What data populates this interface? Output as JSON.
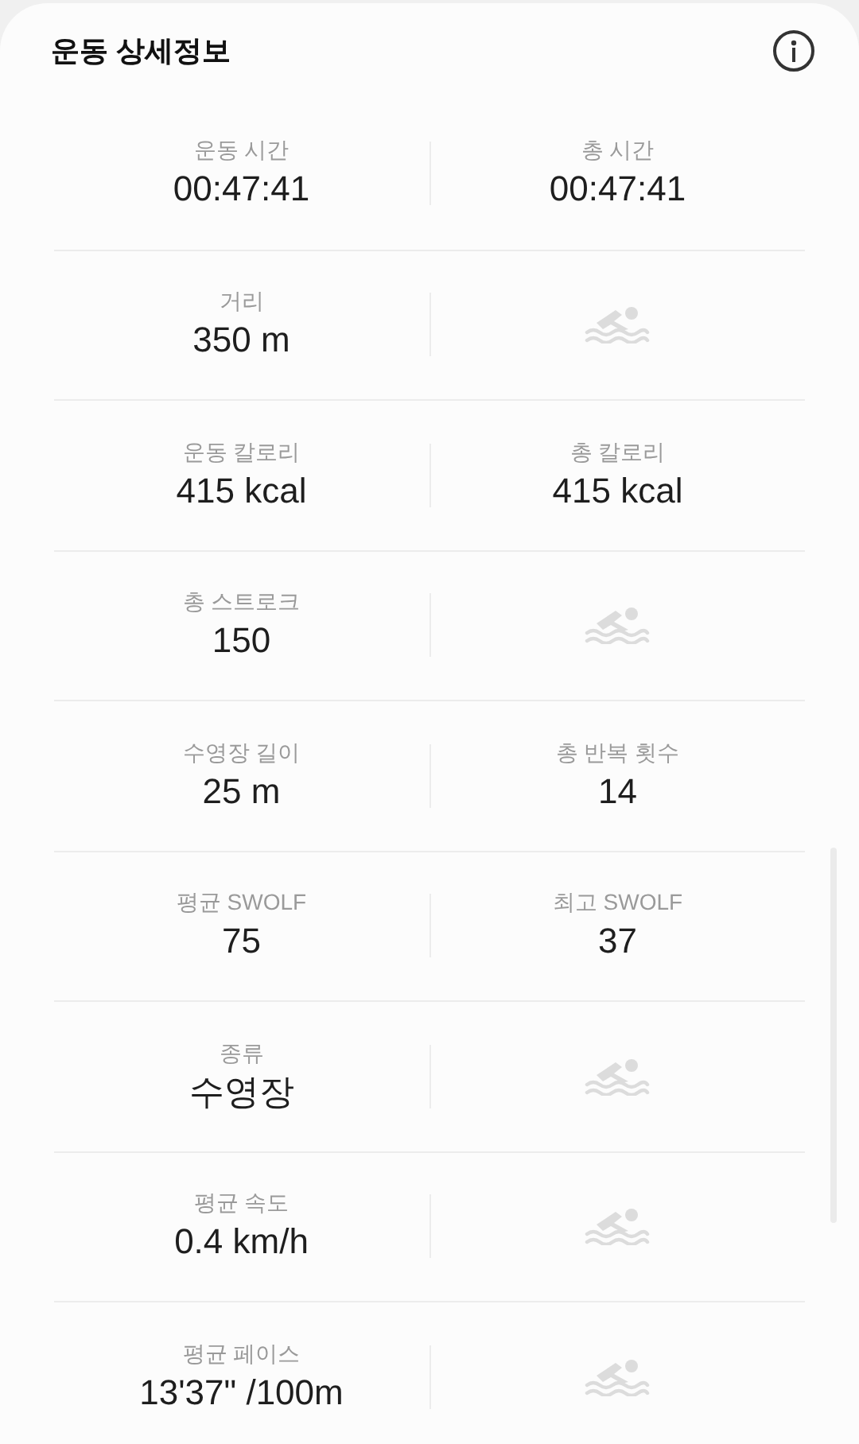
{
  "header": {
    "title": "운동 상세정보"
  },
  "rows": [
    {
      "left": {
        "label": "운동 시간",
        "value": "00:47:41"
      },
      "right": {
        "kind": "stat",
        "label": "총 시간",
        "value": "00:47:41"
      }
    },
    {
      "left": {
        "label": "거리",
        "value": "350 m"
      },
      "right": {
        "kind": "icon"
      }
    },
    {
      "left": {
        "label": "운동 칼로리",
        "value": "415 kcal"
      },
      "right": {
        "kind": "stat",
        "label": "총 칼로리",
        "value": "415 kcal"
      }
    },
    {
      "left": {
        "label": "총 스트로크",
        "value": "150"
      },
      "right": {
        "kind": "icon"
      }
    },
    {
      "left": {
        "label": "수영장 길이",
        "value": "25 m"
      },
      "right": {
        "kind": "stat",
        "label": "총 반복 횟수",
        "value": "14"
      }
    },
    {
      "left": {
        "label": "평균 SWOLF",
        "value": "75"
      },
      "right": {
        "kind": "stat",
        "label": "최고 SWOLF",
        "value": "37"
      }
    },
    {
      "left": {
        "label": "종류",
        "value": "수영장"
      },
      "right": {
        "kind": "icon"
      }
    },
    {
      "left": {
        "label": "평균 속도",
        "value": "0.4 km/h"
      },
      "right": {
        "kind": "icon"
      }
    },
    {
      "left": {
        "label": "평균 페이스",
        "value": "13'37\" /100m"
      },
      "right": {
        "kind": "icon"
      }
    }
  ]
}
